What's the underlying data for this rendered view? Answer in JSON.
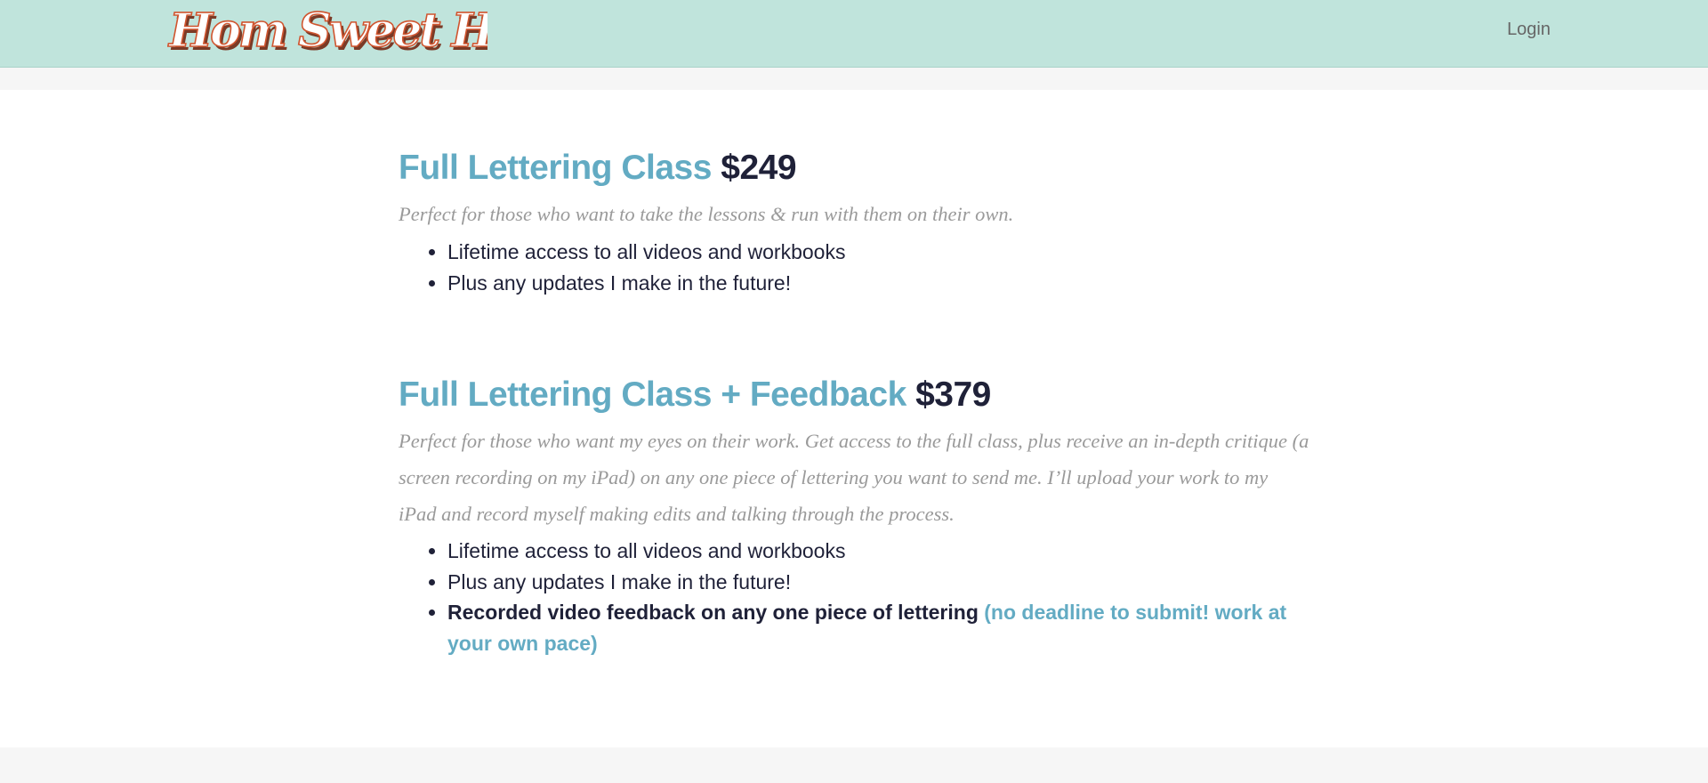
{
  "header": {
    "logo_text": "Hom Sweet Hom",
    "login_label": "Login",
    "background_color": "#c0e4dc"
  },
  "plans": [
    {
      "name": "Full Lettering Class",
      "price": "$249",
      "description": "Perfect for those who want to take the lessons & run with them on their own.",
      "features": [
        "Lifetime access to all videos and workbooks",
        "Plus any updates I make in the future!"
      ]
    },
    {
      "name": "Full Lettering Class + Feedback",
      "price": "$379",
      "description": "Perfect for those who want my eyes on their work. Get access to the full class, plus receive an in-depth critique (a screen recording on my iPad) on any one piece of lettering you want to send me. I’ll upload your work to my iPad and record myself making edits and talking through the process.",
      "features": [
        "Lifetime access to all videos and workbooks",
        "Plus any updates I make in the future!"
      ],
      "highlight_feature": "Recorded video feedback on any one piece of lettering",
      "highlight_note": "(no deadline to submit! work at your own pace)"
    }
  ],
  "colors": {
    "accent": "#63abc3",
    "price": "#1f2138",
    "description": "#9a9a9a",
    "logo_fill": "#ffffff",
    "logo_outline": "#d0552f"
  }
}
